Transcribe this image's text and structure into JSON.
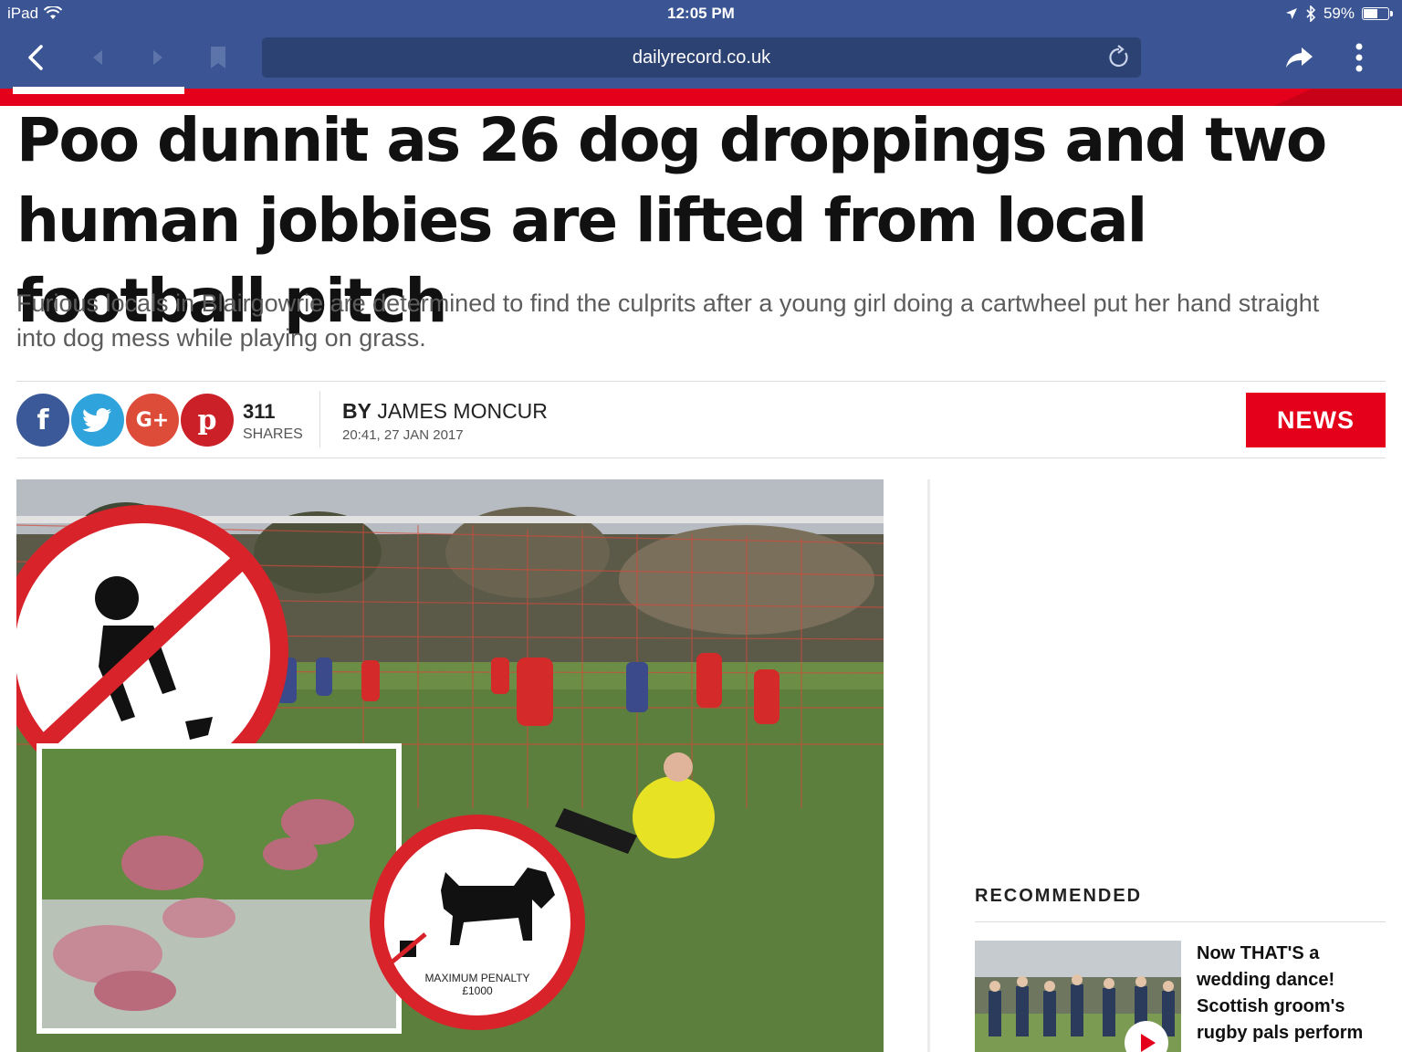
{
  "status_bar": {
    "device": "iPad",
    "time": "12:05 PM",
    "battery": "59%",
    "battery_level": 0.59
  },
  "browser": {
    "url": "dailyrecord.co.uk"
  },
  "article": {
    "headline": "Poo dunnit as 26 dog droppings and two human jobbies are lifted from local football pitch",
    "standfirst": "Furious locals in Blairgowrie are determined to find the culprits after a young girl doing a cartwheel put her hand straight into dog mess while playing on grass.",
    "share_count": "311",
    "share_label": "SHARES",
    "by_label": "BY",
    "author": "JAMES MONCUR",
    "date": "20:41, 27 JAN 2017",
    "section": "NEWS",
    "share_icons": [
      "facebook-icon",
      "twitter-icon",
      "google-plus-icon",
      "pinterest-icon"
    ],
    "sign_text_1": "MAXIMUM PENALTY",
    "sign_text_2": "£1000"
  },
  "recommended": {
    "title": "RECOMMENDED",
    "items": [
      {
        "headline": "Now THAT'S a wedding dance! Scottish groom's rugby pals perform"
      }
    ]
  },
  "colors": {
    "chrome": "#3b5594",
    "brand_red": "#e4001b"
  }
}
